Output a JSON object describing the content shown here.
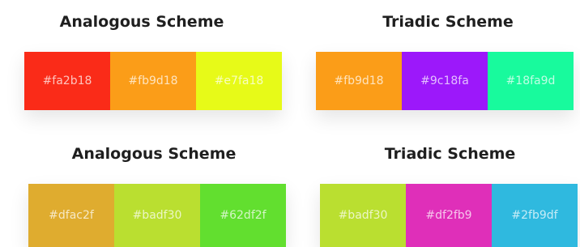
{
  "panels": [
    {
      "title": "Analogous Scheme",
      "swatches": [
        {
          "label": "#fa2b18",
          "color": "#fa2b18"
        },
        {
          "label": "#fb9d18",
          "color": "#fb9d18"
        },
        {
          "label": "#e7fa18",
          "color": "#e7fa18"
        }
      ]
    },
    {
      "title": "Triadic Scheme",
      "swatches": [
        {
          "label": "#fb9d18",
          "color": "#fb9d18"
        },
        {
          "label": "#9c18fa",
          "color": "#9c18fa"
        },
        {
          "label": "#18fa9d",
          "color": "#18fa9d"
        }
      ]
    },
    {
      "title": "Analogous Scheme",
      "swatches": [
        {
          "label": "#dfac2f",
          "color": "#dfac2f"
        },
        {
          "label": "#badf30",
          "color": "#badf30"
        },
        {
          "label": "#62df2f",
          "color": "#62df2f"
        }
      ]
    },
    {
      "title": "Triadic Scheme",
      "swatches": [
        {
          "label": "#badf30",
          "color": "#badf30"
        },
        {
          "label": "#df2fb9",
          "color": "#df2fb9"
        },
        {
          "label": "#2fb9df",
          "color": "#2fb9df"
        }
      ]
    }
  ]
}
